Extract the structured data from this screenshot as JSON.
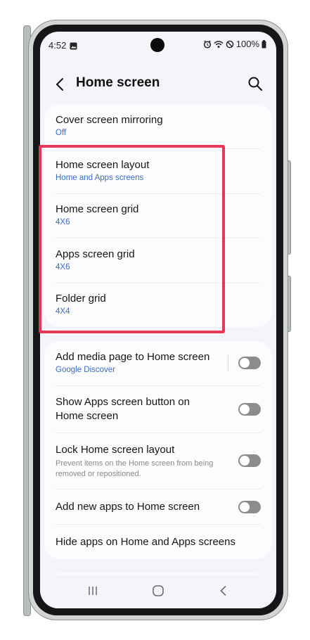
{
  "status_bar": {
    "time": "4:52",
    "battery": "100%",
    "icons": [
      "gallery-icon",
      "alarm-icon",
      "wifi-icon",
      "do-not-disturb-icon",
      "battery-icon"
    ]
  },
  "header": {
    "title": "Home screen",
    "icons": [
      "back-arrow-icon",
      "search-icon"
    ]
  },
  "group1": {
    "items": [
      {
        "title": "Cover screen mirroring",
        "subtitle": "Off"
      },
      {
        "title": "Home screen layout",
        "subtitle": "Home and Apps screens"
      },
      {
        "title": "Home screen grid",
        "subtitle": "4X6"
      },
      {
        "title": "Apps screen grid",
        "subtitle": "4X6"
      },
      {
        "title": "Folder grid",
        "subtitle": "4X4"
      }
    ]
  },
  "group2": {
    "items": [
      {
        "title": "Add media page to Home screen",
        "subtitle": "Google Discover",
        "toggle": false
      },
      {
        "title_line1": "Show Apps screen button on",
        "title_line2": "Home screen",
        "toggle": false
      },
      {
        "title": "Lock Home screen layout",
        "description_line1": "Prevent items on the Home screen from being",
        "description_line2": "removed or repositioned.",
        "toggle": false
      },
      {
        "title": "Add new apps to Home screen",
        "toggle": false
      },
      {
        "title": "Hide apps on Home and Apps screens"
      }
    ]
  },
  "nav_bar": {
    "icons": [
      "recents-icon",
      "home-icon",
      "back-icon"
    ]
  },
  "colors": {
    "accent_blue": "#3c6cc6",
    "highlight_red": "#e8385a",
    "toggle_off": "#8a8c8e",
    "screen_bg": "#f5f4f9",
    "card_bg": "#fcfcfe"
  }
}
